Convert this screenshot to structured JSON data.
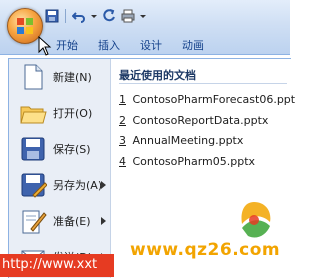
{
  "ribbon": {
    "tabs": [
      "开始",
      "插入",
      "设计",
      "动画"
    ]
  },
  "quick_access": {
    "icons": [
      "save-icon",
      "undo-icon",
      "dropdown-icon",
      "redo-icon",
      "print-icon",
      "dropdown-icon"
    ]
  },
  "menu": {
    "items": [
      {
        "label": "新建(N)",
        "icon": "new-document-icon",
        "submenu": false
      },
      {
        "label": "打开(O)",
        "icon": "open-folder-icon",
        "submenu": false
      },
      {
        "label": "保存(S)",
        "icon": "save-disk-icon",
        "submenu": false
      },
      {
        "label": "另存为(A)",
        "icon": "save-as-icon",
        "submenu": true
      },
      {
        "label": "准备(E)",
        "icon": "prepare-icon",
        "submenu": true
      },
      {
        "label": "发送(D)",
        "icon": "send-icon",
        "submenu": true
      }
    ],
    "recent_title": "最近使用的文档",
    "recent": [
      {
        "num": "1",
        "name": "ContosoPharmForecast06.ppt"
      },
      {
        "num": "2",
        "name": "ContosoReportData.pptx"
      },
      {
        "num": "3",
        "name": "AnnualMeeting.pptx"
      },
      {
        "num": "4",
        "name": "ContosoPharm05.pptx"
      }
    ]
  },
  "watermark": {
    "url_right": "www.qz26.com",
    "url_left": "http://www.xxt"
  },
  "colors": {
    "ribbon_text": "#15428b",
    "watermark_orange": "#f2a400",
    "watermark_red": "#e63b22"
  }
}
